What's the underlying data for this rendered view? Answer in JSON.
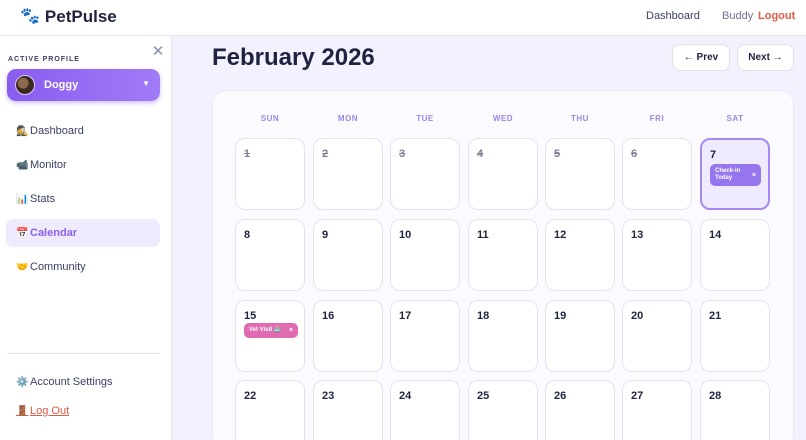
{
  "header": {
    "brand": "PetPulse",
    "nav_dashboard": "Dashboard",
    "username": "Buddy",
    "logout": "Logout"
  },
  "sidebar": {
    "profile_label": "ACTIVE PROFILE",
    "profile_name": "Doggy",
    "items": [
      {
        "icon": "🕵",
        "label": "Dashboard"
      },
      {
        "icon": "📹",
        "label": "Monitor"
      },
      {
        "icon": "📊",
        "label": "Stats"
      },
      {
        "icon": "📅",
        "label": "Calendar"
      },
      {
        "icon": "🤝",
        "label": "Community"
      }
    ],
    "account_settings": {
      "icon": "⚙️",
      "label": "Account Settings"
    },
    "log_out": {
      "icon": "🚪",
      "label": "Log Out"
    }
  },
  "calendar": {
    "month_title": "February 2026",
    "prev_label": "← Prev",
    "next_label": "Next →",
    "weekdays": [
      "SUN",
      "MON",
      "TUE",
      "WED",
      "THU",
      "FRI",
      "SAT"
    ],
    "weeks": [
      [
        "1",
        "2",
        "3",
        "4",
        "5",
        "6",
        "7"
      ],
      [
        "8",
        "9",
        "10",
        "11",
        "12",
        "13",
        "14"
      ],
      [
        "15",
        "16",
        "17",
        "18",
        "19",
        "20",
        "21"
      ],
      [
        "22",
        "23",
        "24",
        "25",
        "26",
        "27",
        "28"
      ]
    ],
    "events": {
      "checkin_today": "Check-in Today",
      "vet_visit": "Vet Visit 🏥"
    },
    "remove_glyph": "×"
  },
  "colors": {
    "accent": "#8a62ee",
    "danger": "#e25a45",
    "event_purple": "#9676ee",
    "event_pink": "#e06bb0"
  }
}
